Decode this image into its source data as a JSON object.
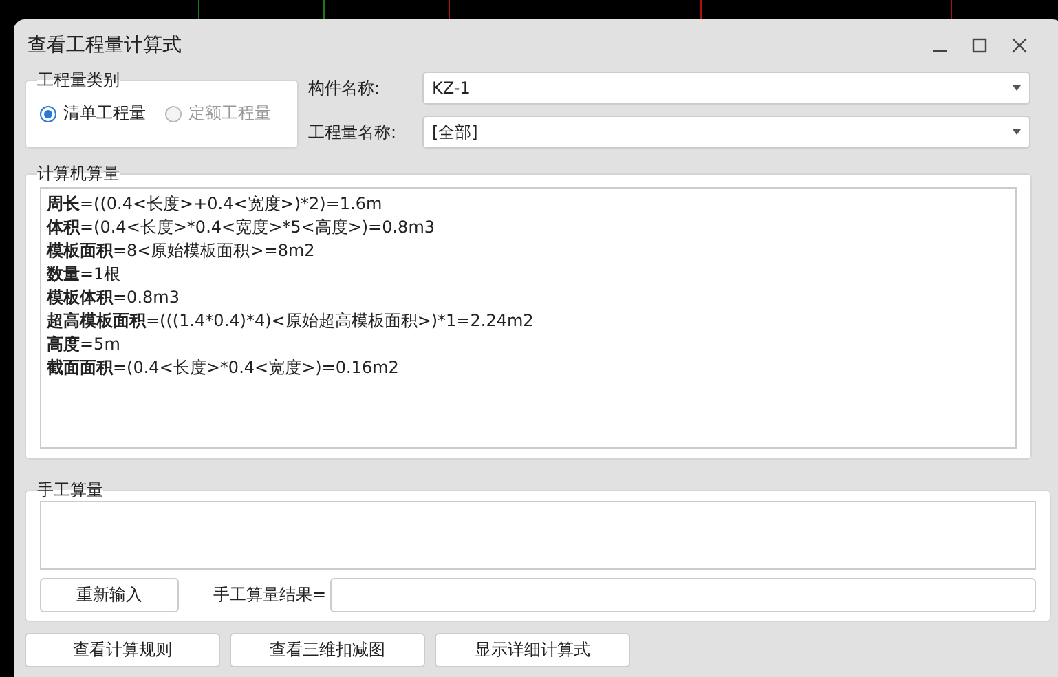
{
  "window": {
    "title": "查看工程量计算式"
  },
  "quantity_type": {
    "legend": "工程量类别",
    "options": [
      {
        "label": "清单工程量",
        "selected": true,
        "disabled": false
      },
      {
        "label": "定额工程量",
        "selected": false,
        "disabled": true
      }
    ]
  },
  "fields": [
    {
      "label": "构件名称:",
      "value": "KZ-1"
    },
    {
      "label": "工程量名称:",
      "value": "[全部]"
    }
  ],
  "computed": {
    "legend": "计算机算量",
    "lines": [
      "**周长**=((0.4<长度>+0.4<宽度>)*2)=1.6m",
      "**体积**=(0.4<长度>*0.4<宽度>*5<高度>)=0.8m3",
      "**模板面积**=8<原始模板面积>=8m2",
      "**数量**=1根",
      "**模板体积**=0.8m3",
      "**超高模板面积**=(((1.4*0.4)*4)<原始超高模板面积>)*1=2.24m2",
      "**高度**=5m",
      "**截面面积**=(0.4<长度>*0.4<宽度>)=0.16m2"
    ]
  },
  "manual": {
    "legend": "手工算量",
    "reset_button": "重新输入",
    "result_label": "手工算量结果="
  },
  "buttons": [
    "查看计算规则",
    "查看三维扣减图",
    "显示详细计算式"
  ]
}
